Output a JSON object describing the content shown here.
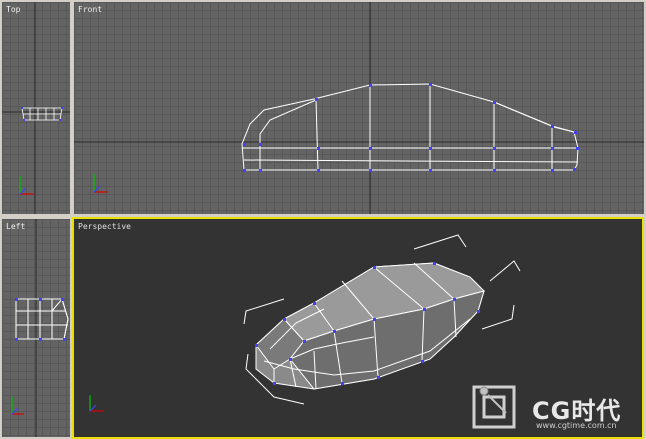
{
  "viewports": {
    "top": {
      "label": "Top"
    },
    "front": {
      "label": "Front"
    },
    "left": {
      "label": "Left"
    },
    "perspective": {
      "label": "Perspective"
    }
  },
  "watermark": {
    "brand": "CG时代",
    "url": "www.cgtime.com.cn"
  },
  "colors": {
    "active_border": "#e8e000",
    "wire": "#ffffff",
    "vertex": "#4040ff",
    "grid": "#646464",
    "persp_bg": "#333333"
  }
}
